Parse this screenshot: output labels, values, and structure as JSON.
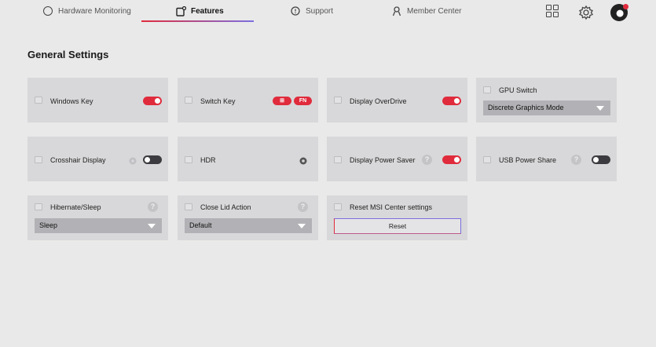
{
  "nav": {
    "tabs": [
      {
        "label": "Hardware Monitoring",
        "icon": "gauge-icon"
      },
      {
        "label": "Features",
        "icon": "features-icon",
        "active": true
      },
      {
        "label": "Support",
        "icon": "chat-icon"
      },
      {
        "label": "Member Center",
        "icon": "person-icon"
      }
    ],
    "accent_gradient": [
      "#e02b3c",
      "#7b6fe0"
    ]
  },
  "page": {
    "title": "General Settings"
  },
  "cards": {
    "windows_key": {
      "label": "Windows Key",
      "on": true
    },
    "switch_key": {
      "label": "Switch Key",
      "win_pill": "⊞",
      "fn_pill": "FN"
    },
    "display_overdrive": {
      "label": "Display OverDrive",
      "on": true
    },
    "gpu_switch": {
      "label": "GPU Switch",
      "value": "Discrete Graphics Mode"
    },
    "crosshair": {
      "label": "Crosshair Display",
      "on": false
    },
    "hdr": {
      "label": "HDR"
    },
    "power_saver": {
      "label": "Display Power Saver",
      "help": "?",
      "on": true
    },
    "usb_power_share": {
      "label": "USB Power Share",
      "help": "?",
      "on": false
    },
    "hibernate": {
      "label": "Hibernate/Sleep",
      "help": "?",
      "value": "Sleep"
    },
    "close_lid": {
      "label": "Close Lid Action",
      "help": "?",
      "value": "Default"
    },
    "reset": {
      "label": "Reset MSI Center settings",
      "button": "Reset"
    }
  },
  "colors": {
    "accent": "#e02b3c",
    "toggle_off": "#3c3c40",
    "card_bg": "#d8d8da",
    "select_bg": "#b2b2b6"
  }
}
